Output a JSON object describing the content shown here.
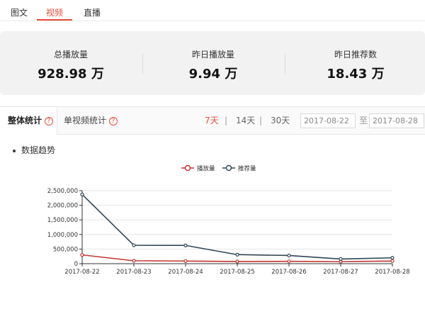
{
  "tabs": [
    "图文",
    "视频",
    "直播"
  ],
  "active_tab": "视频",
  "stats": [
    {
      "label": "总播放量",
      "value": "928.98 万"
    },
    {
      "label": "昨日播放量",
      "value": "9.94 万"
    },
    {
      "label": "昨日推荐数",
      "value": "18.43 万"
    }
  ],
  "stat_tabs": {
    "overall": "整体统计",
    "single": "单视频统计",
    "help_icon": "?"
  },
  "ranges": [
    "7天",
    "14天",
    "30天"
  ],
  "range_separator": "|",
  "date_from": "2017-08-22",
  "date_to": "2017-08-28",
  "date_between": "至",
  "section_title": "数据趋势",
  "colors": {
    "accent": "#e84c3d",
    "play": "#c23531",
    "recommend": "#2f4554"
  },
  "chart_data": {
    "type": "line",
    "title": "",
    "xlabel": "",
    "ylabel": "",
    "x": [
      "2017-08-22",
      "2017-08-23",
      "2017-08-24",
      "2017-08-25",
      "2017-08-26",
      "2017-08-27",
      "2017-08-28"
    ],
    "ylim": [
      0,
      2500000
    ],
    "yticks": [
      0,
      500000,
      1000000,
      1500000,
      2000000,
      2500000
    ],
    "ytick_labels": [
      "0",
      "500,000",
      "1,000,000",
      "1,500,000",
      "2,000,000",
      "2,500,000"
    ],
    "grid": true,
    "legend": "top-center",
    "series": [
      {
        "name": "播放量",
        "color": "#c23531",
        "values": [
          300000,
          100000,
          90000,
          75000,
          80000,
          70000,
          90000
        ]
      },
      {
        "name": "推荐量",
        "color": "#2f4554",
        "values": [
          2370000,
          630000,
          625000,
          310000,
          280000,
          160000,
          200000
        ]
      }
    ]
  }
}
